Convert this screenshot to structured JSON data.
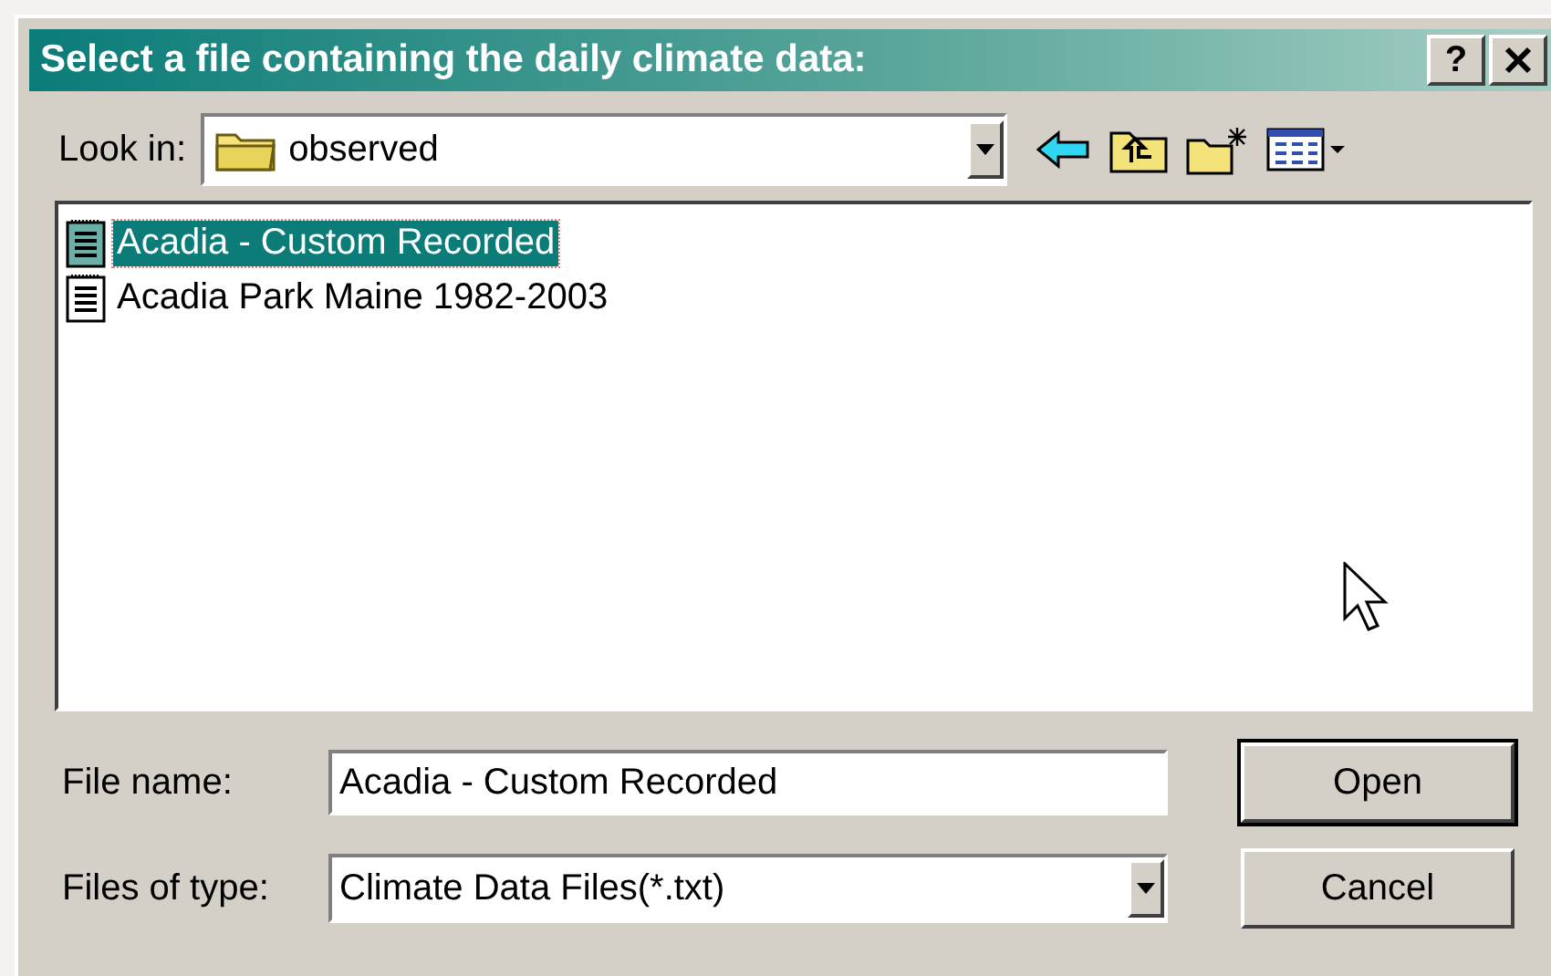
{
  "window": {
    "title": "Select a file containing the daily climate data:",
    "help_button": "?"
  },
  "look_in": {
    "label": "Look in:",
    "value": "observed"
  },
  "files": [
    {
      "name": "Acadia - Custom Recorded",
      "selected": true
    },
    {
      "name": "Acadia Park Maine 1982-2003",
      "selected": false
    }
  ],
  "file_name": {
    "label": "File name:",
    "value": "Acadia - Custom Recorded"
  },
  "files_of_type": {
    "label": "Files of type:",
    "value": "Climate Data Files(*.txt)"
  },
  "buttons": [
    {
      "label": "Open",
      "default": true
    },
    {
      "label": "Cancel",
      "default": false
    }
  ]
}
